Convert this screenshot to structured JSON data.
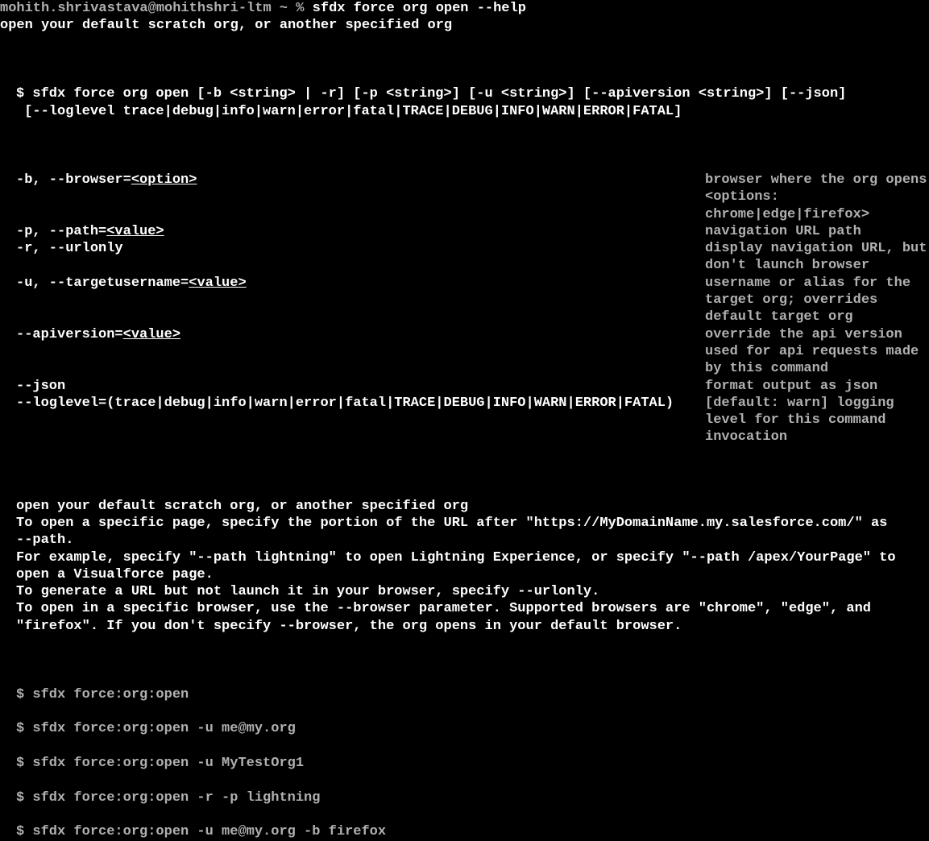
{
  "prompt": {
    "user_host": "mohith.shrivastava@mohithshri-ltm ~ % ",
    "cmd": "sfdx force org open --help"
  },
  "summary_line": "open your default scratch org, or another specified org",
  "usage": {
    "line1": "$ sfdx force org open [-b <string> | -r] [-p <string>] [-u <string>] [--apiversion <string>] [--json]",
    "line2": " [--loglevel trace|debug|info|warn|error|fatal|TRACE|DEBUG|INFO|WARN|ERROR|FATAL]"
  },
  "options": {
    "browser": {
      "flag": "-b, --browser=",
      "arg": "<option>",
      "desc1": "browser where the org opens",
      "desc2": "<options:",
      "desc3": "chrome|edge|firefox>"
    },
    "path": {
      "flag": "-p, --path=",
      "arg": "<value>",
      "desc": "navigation URL path"
    },
    "urlonly": {
      "flag": "-r, --urlonly",
      "desc1": "display navigation URL, but",
      "desc2": "don't launch browser"
    },
    "targetusername": {
      "flag": "-u, --targetusername=",
      "arg": "<value>",
      "desc1": "username or alias for the",
      "desc2": "target org; overrides",
      "desc3": "default target org"
    },
    "apiversion": {
      "flag": "--apiversion=",
      "arg": "<value>",
      "desc1": "override the api version",
      "desc2": "used for api requests made",
      "desc3": "by this command"
    },
    "json": {
      "flag": "--json",
      "desc": "format output as json"
    },
    "loglevel": {
      "flag": "--loglevel=(trace|debug|info|warn|error|fatal|TRACE|DEBUG|INFO|WARN|ERROR|FATAL)",
      "desc1": "[default: warn] logging",
      "desc2": "level for this command",
      "desc3": "invocation"
    }
  },
  "description": {
    "d1": "open your default scratch org, or another specified org",
    "d2": "To open a specific page, specify the portion of the URL after \"https://MyDomainName.my.salesforce.com/\" as",
    "d3": "--path.",
    "d4": "For example, specify \"--path lightning\" to open Lightning Experience, or specify \"--path /apex/YourPage\" to",
    "d5": "open a Visualforce page.",
    "d6": "To generate a URL but not launch it in your browser, specify --urlonly.",
    "d7": "To open in a specific browser, use the --browser parameter. Supported browsers are \"chrome\", \"edge\", and",
    "d8": "\"firefox\". If you don't specify --browser, the org opens in your default browser."
  },
  "examples": {
    "e1": "$ sfdx force:org:open",
    "e2": "$ sfdx force:org:open -u me@my.org",
    "e3": "$ sfdx force:org:open -u MyTestOrg1",
    "e4": "$ sfdx force:org:open -r -p lightning",
    "e5": "$ sfdx force:org:open -u me@my.org -b firefox"
  }
}
